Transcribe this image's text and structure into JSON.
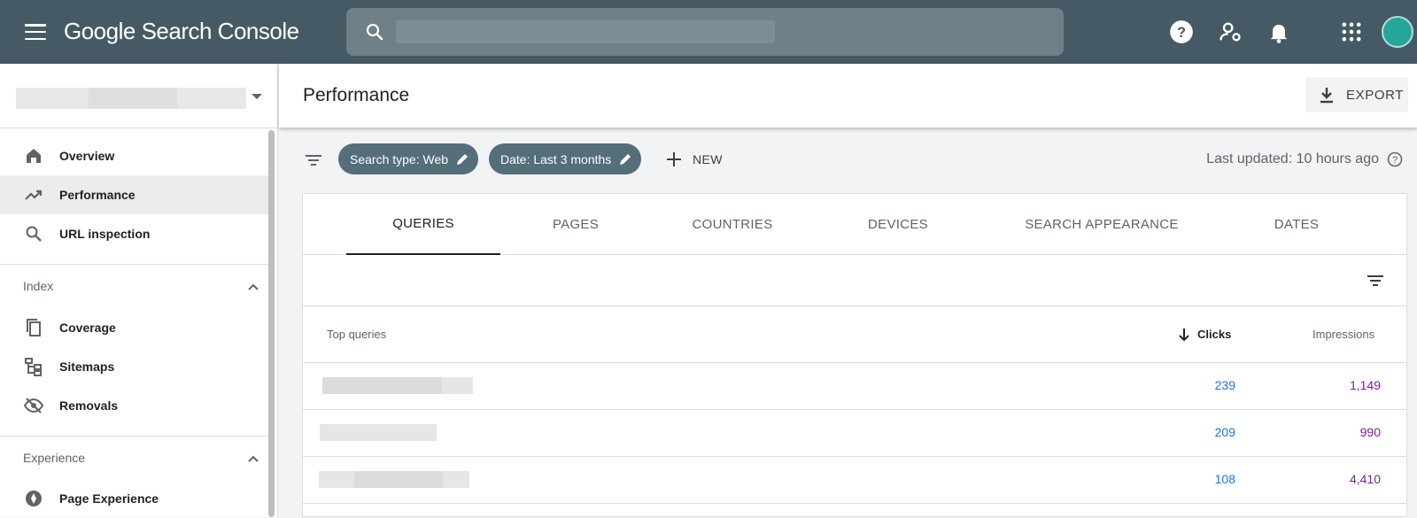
{
  "app": {
    "title": "Google Search Console",
    "colors": {
      "topbar": "#455a64",
      "chip": "#546e7a",
      "clicks": "#1a73e8",
      "impressions": "#7b1fa2"
    }
  },
  "sidebar": {
    "items_top": [
      {
        "label": "Overview",
        "icon": "home-icon"
      },
      {
        "label": "Performance",
        "icon": "trending-up-icon",
        "active": true
      },
      {
        "label": "URL inspection",
        "icon": "search-icon"
      }
    ],
    "index_section": {
      "title": "Index",
      "items": [
        {
          "label": "Coverage",
          "icon": "coverage-icon"
        },
        {
          "label": "Sitemaps",
          "icon": "sitemap-icon"
        },
        {
          "label": "Removals",
          "icon": "eye-off-icon"
        }
      ]
    },
    "experience_section": {
      "title": "Experience",
      "items": [
        {
          "label": "Page Experience",
          "icon": "page-experience-icon"
        }
      ]
    }
  },
  "header": {
    "title": "Performance",
    "export_label": "EXPORT"
  },
  "filters": {
    "chips": [
      "Search type: Web",
      "Date: Last 3 months"
    ],
    "new_label": "NEW",
    "last_updated": "Last updated: 10 hours ago"
  },
  "tabs": [
    {
      "label": "QUERIES",
      "active": true
    },
    {
      "label": "PAGES"
    },
    {
      "label": "COUNTRIES"
    },
    {
      "label": "DEVICES"
    },
    {
      "label": "SEARCH APPEARANCE"
    },
    {
      "label": "DATES"
    }
  ],
  "table": {
    "headers": {
      "query": "Top queries",
      "clicks": "Clicks",
      "impressions": "Impressions"
    },
    "rows": [
      {
        "clicks": "239",
        "impressions": "1,149"
      },
      {
        "clicks": "209",
        "impressions": "990"
      },
      {
        "clicks": "108",
        "impressions": "4,410"
      }
    ]
  }
}
